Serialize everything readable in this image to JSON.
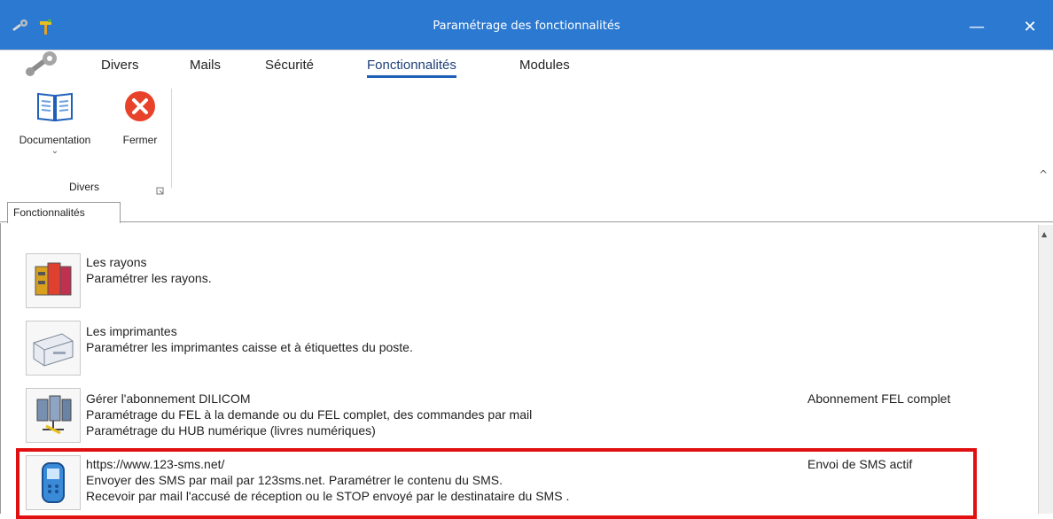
{
  "window": {
    "title": "Paramétrage des fonctionnalités",
    "minimize_label": "—",
    "close_label": "✕",
    "titlebar_color": "#2b79d0"
  },
  "menu": {
    "tabs": [
      {
        "label": "Divers"
      },
      {
        "label": "Mails"
      },
      {
        "label": "Sécurité"
      },
      {
        "label": "Fonctionnalités",
        "active": true
      },
      {
        "label": "Modules"
      }
    ]
  },
  "ribbon": {
    "documentation_label": "Documentation",
    "fermer_label": "Fermer",
    "group_label": "Divers",
    "collapse_glyph": "^",
    "dropdown_glyph": "⌄"
  },
  "doc_tab": {
    "label": "Fonctionnalités"
  },
  "items": [
    {
      "icon": "shelves-icon",
      "title": "Les rayons",
      "lines": [
        "Paramétrer les rayons."
      ],
      "status": ""
    },
    {
      "icon": "printer-icon",
      "title": "Les imprimantes",
      "lines": [
        "Paramétrer les imprimantes caisse et à étiquettes du poste."
      ],
      "status": ""
    },
    {
      "icon": "network-icon",
      "title": "Gérer l'abonnement DILICOM",
      "lines": [
        "Paramétrage du FEL à la demande ou du FEL complet, des commandes par mail",
        "Paramétrage du HUB numérique (livres numériques)"
      ],
      "status": "Abonnement FEL complet"
    },
    {
      "icon": "phone-icon",
      "title": "https://www.123-sms.net/",
      "lines": [
        "Envoyer des SMS par mail par 123sms.net. Paramétrer le contenu du SMS.",
        "Recevoir par mail l'accusé de réception ou le STOP envoyé par le destinataire du SMS ."
      ],
      "status": "Envoi de SMS actif"
    }
  ],
  "highlight_color": "#e01010"
}
